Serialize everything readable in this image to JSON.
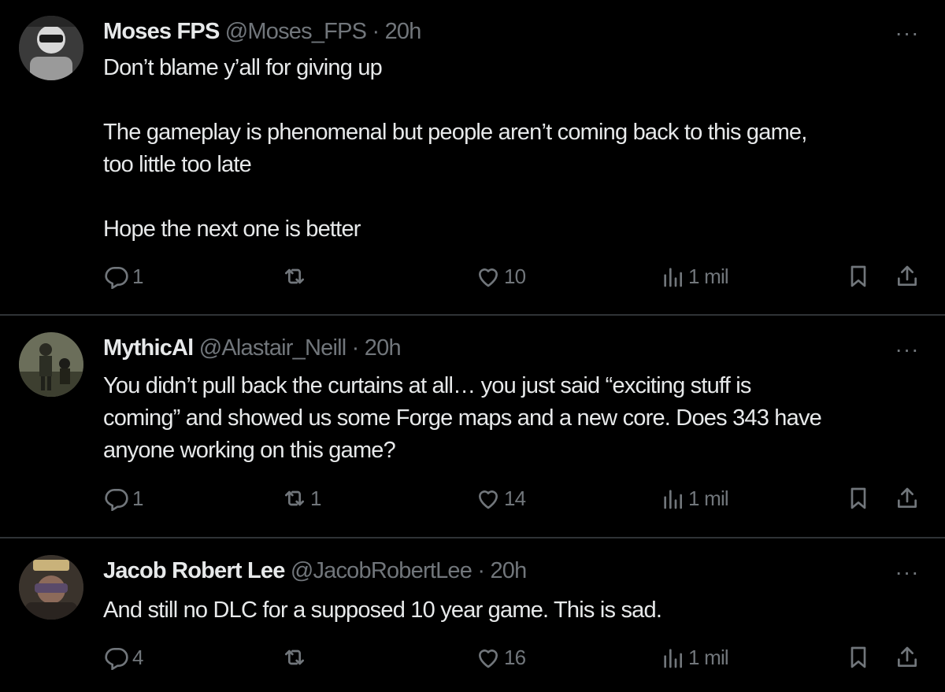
{
  "tweets": [
    {
      "name": "Moses FPS",
      "handle": "@Moses_FPS",
      "dot": "·",
      "time": "20h",
      "more": "···",
      "lines": [
        "Don’t blame y’all for giving up",
        "",
        "The gameplay is phenomenal but people aren’t coming back to this game,",
        "too little too late",
        "",
        "Hope the next one is better"
      ],
      "replies": "1",
      "reposts": "",
      "likes": "10",
      "views": "1 mil",
      "avatar_color": "#4a4a4a"
    },
    {
      "name": "MythicAl",
      "handle": "@Alastair_Neill",
      "dot": "·",
      "time": "20h",
      "more": "···",
      "lines": [
        "You didn’t pull back the curtains at all… you just said “exciting stuff is",
        "coming” and showed us some Forge maps and a new core. Does 343 have",
        "anyone working on this game?"
      ],
      "replies": "1",
      "reposts": "1",
      "likes": "14",
      "views": "1 mil",
      "avatar_color": "#5a5a4a"
    },
    {
      "name": "Jacob Robert Lee",
      "handle": "@JacobRobertLee",
      "dot": "·",
      "time": "20h",
      "more": "···",
      "lines": [
        "And still no DLC for a supposed 10 year game. This is sad."
      ],
      "replies": "4",
      "reposts": "",
      "likes": "16",
      "views": "1 mil",
      "avatar_color": "#6a5a4a"
    }
  ],
  "icons": {
    "reply": "reply-icon",
    "repost": "repost-icon",
    "like": "like-icon",
    "views": "views-icon",
    "bookmark": "bookmark-icon",
    "share": "share-icon"
  },
  "colors": {
    "background": "#000000",
    "text": "#e7e9ea",
    "secondary": "#71767b",
    "divider": "#2f3336"
  }
}
